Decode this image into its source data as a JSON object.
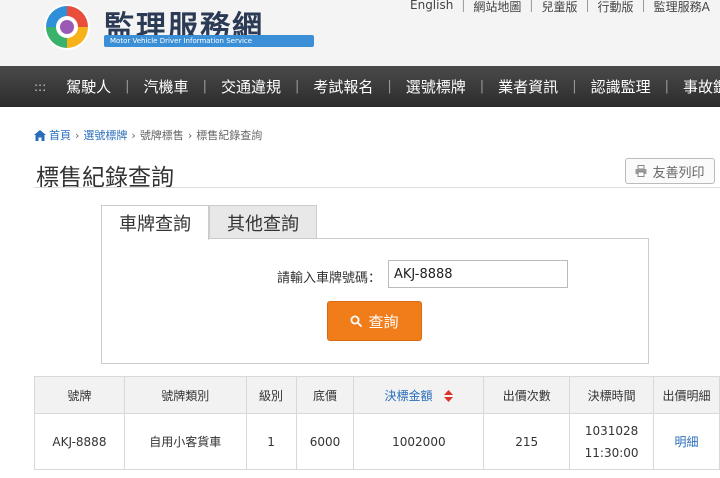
{
  "header": {
    "logo_title": "監理服務網",
    "logo_subtitle": "Motor Vehicle Driver Information Service",
    "top_links": [
      "English",
      "網站地圖",
      "兒童版",
      "行動版",
      "監理服務A"
    ]
  },
  "nav": {
    "items": [
      "駕駛人",
      "汽機車",
      "交通違規",
      "考試報名",
      "選號標牌",
      "業者資訊",
      "認識監理",
      "事故鑑定"
    ]
  },
  "breadcrumb": {
    "home": "首頁",
    "level1": "選號標牌",
    "level2": "號牌標售",
    "current": "標售紀錄查詢"
  },
  "page": {
    "title": "標售紀錄查詢",
    "print_label": "友善列印"
  },
  "tabs": {
    "plate_query": "車牌查詢",
    "other_query": "其他查詢"
  },
  "form": {
    "label": "請輸入車牌號碼：",
    "plate_value": "AKJ-8888",
    "search_label": "查詢"
  },
  "table": {
    "headers": [
      "號牌",
      "號牌類別",
      "級別",
      "底價",
      "決標金額",
      "出價次數",
      "決標時間",
      "出價明細"
    ],
    "rows": [
      {
        "plate": "AKJ-8888",
        "type": "自用小客貨車",
        "level": "1",
        "base_price": "6000",
        "winning_bid": "1002000",
        "bid_count": "215",
        "award_date": "1031028",
        "award_time": "11:30:00",
        "detail": "明細"
      }
    ]
  },
  "colors": {
    "accent": "#f07d1a",
    "link": "#2a6ebb",
    "nav_bg": "#333333"
  }
}
